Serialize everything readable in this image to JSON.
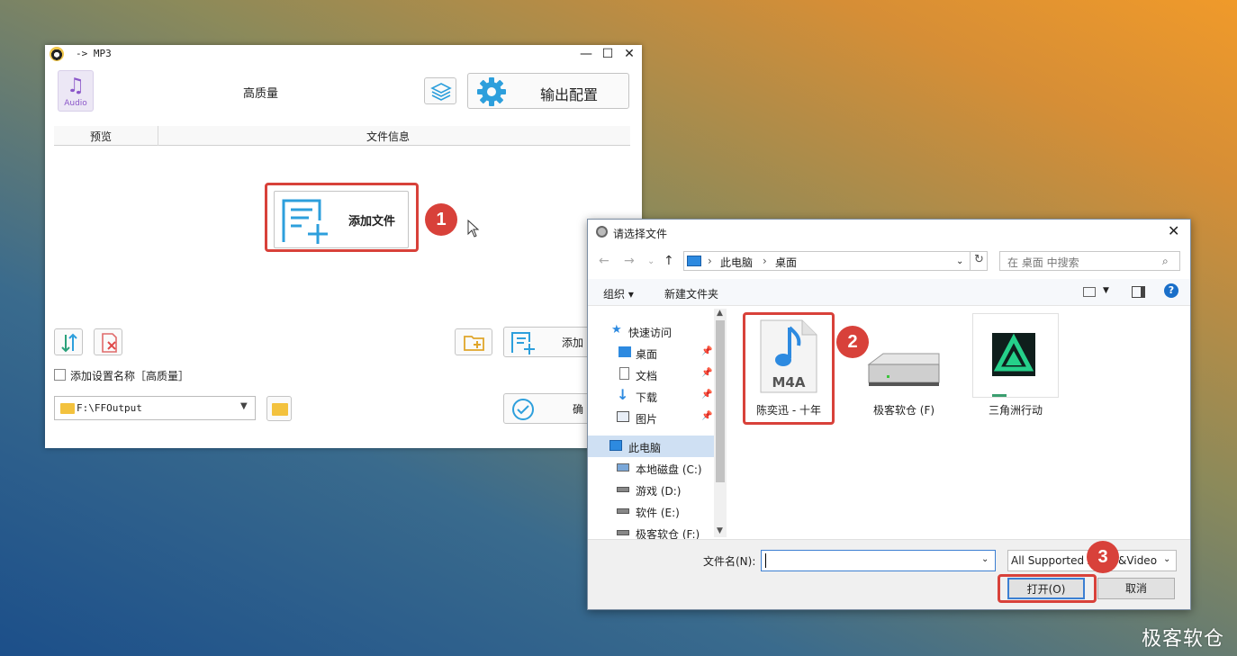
{
  "converter": {
    "title": "-> MP3",
    "audio_label": "Audio",
    "quality": "高质量",
    "output_config": "输出配置",
    "col_preview": "预览",
    "col_fileinfo": "文件信息",
    "add_file": "添加文件",
    "add_btn2": "添加",
    "checkbox_label": "添加设置名称［高质量］",
    "output_path": "F:\\FFOutput",
    "confirm": "确"
  },
  "dialog": {
    "title": "请选择文件",
    "address": [
      "此电脑",
      "桌面"
    ],
    "search_placeholder": "在 桌面 中搜索",
    "organize": "组织 ▾",
    "new_folder": "新建文件夹",
    "help": "?",
    "sidebar": [
      {
        "label": "快速访问"
      },
      {
        "label": "桌面"
      },
      {
        "label": "文档"
      },
      {
        "label": "下载"
      },
      {
        "label": "图片"
      },
      {
        "label": "此电脑"
      },
      {
        "label": "本地磁盘 (C:)"
      },
      {
        "label": "游戏 (D:)"
      },
      {
        "label": "软件 (E:)"
      },
      {
        "label": "极客软仓 (F:)"
      }
    ],
    "files": [
      {
        "name": "陈奕迅 - 十年",
        "type_label": "M4A"
      },
      {
        "name": "极客软仓 (F)"
      },
      {
        "name": "三角洲行动"
      }
    ],
    "filename_label": "文件名(N):",
    "filename_value": "",
    "filter": "All Supported Audio&Video",
    "open": "打开(O)",
    "cancel": "取消"
  },
  "badges": [
    "1",
    "2",
    "3"
  ],
  "watermark": "极客软仓",
  "colors": {
    "highlight": "#d8413a",
    "accent": "#2d9fdc"
  }
}
